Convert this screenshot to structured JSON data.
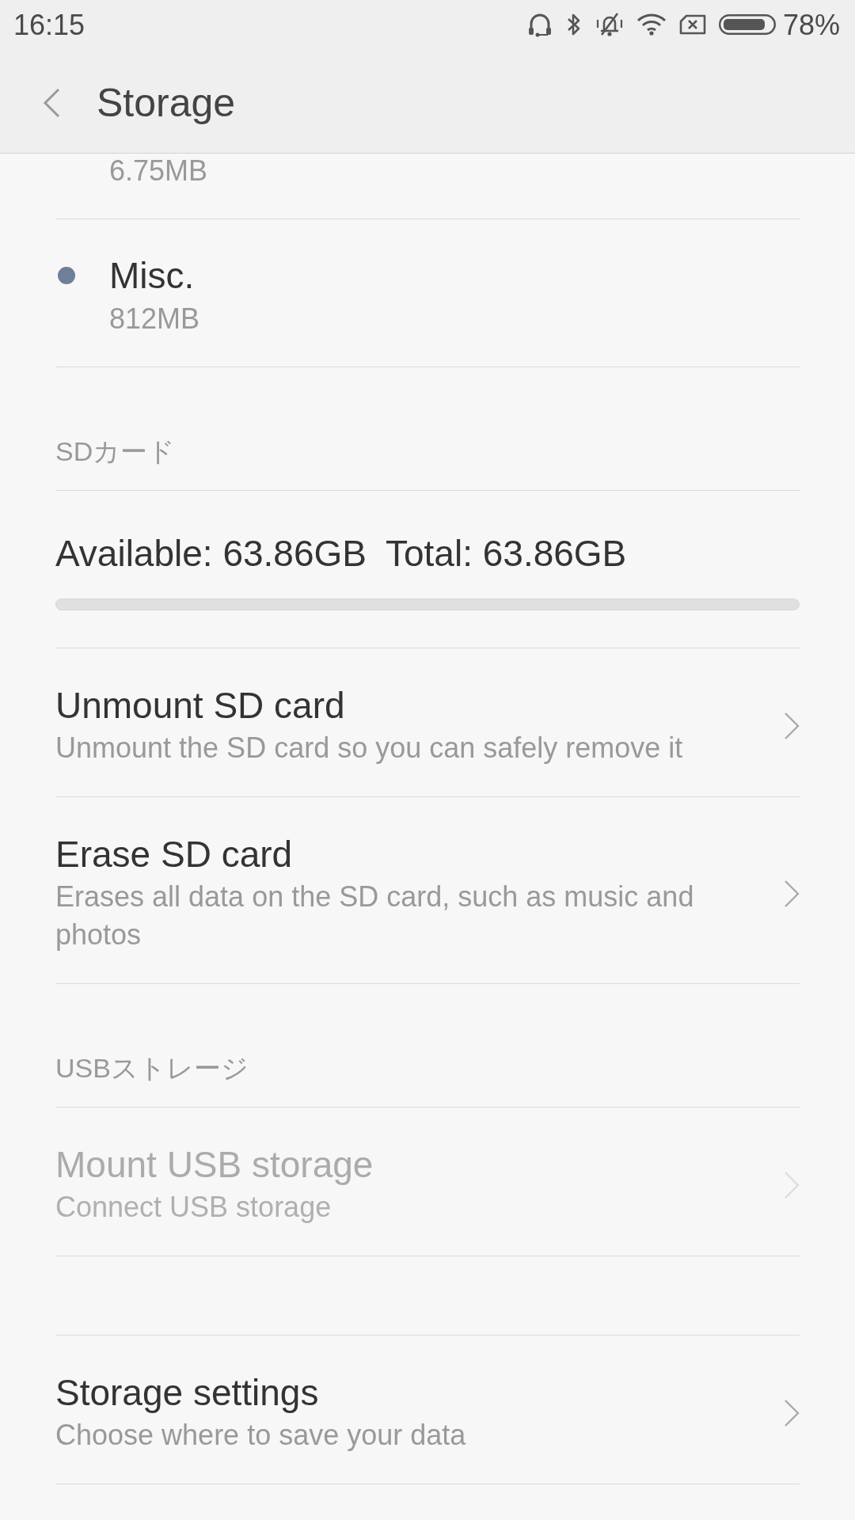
{
  "status_bar": {
    "time": "16:15",
    "battery": "78%"
  },
  "header": {
    "title": "Storage"
  },
  "storage_items": [
    {
      "size": "6.75MB"
    },
    {
      "name": "Misc.",
      "size": "812MB",
      "color": "#6e7f99"
    }
  ],
  "sections": [
    {
      "header": "SDカード",
      "usage": {
        "available": "Available: 63.86GB",
        "total": "Total: 63.86GB",
        "level": 0
      },
      "items": [
        {
          "title": "Unmount SD card",
          "subtitle": "Unmount the SD card so you can safely remove it",
          "disabled": false
        },
        {
          "title": "Erase SD card",
          "subtitle": "Erases all data on the SD card, such as music and photos",
          "disabled": false
        }
      ]
    },
    {
      "header": "USBストレージ",
      "items": [
        {
          "title": "Mount USB storage",
          "subtitle": "Connect USB storage",
          "disabled": true
        }
      ]
    },
    {
      "items": [
        {
          "title": "Storage settings",
          "subtitle": "Choose where to save your data",
          "disabled": false
        }
      ]
    }
  ]
}
